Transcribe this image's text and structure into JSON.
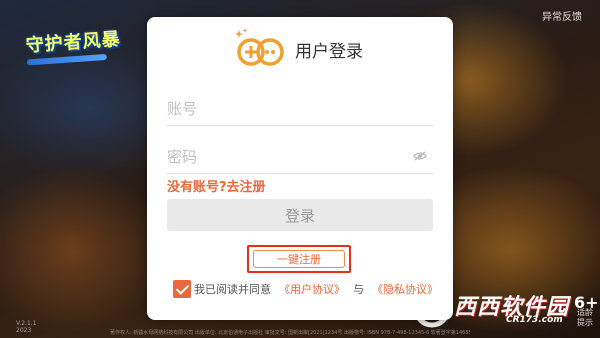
{
  "background": {
    "game_logo_text": "守护者风暴",
    "feedback_label": "异常反馈",
    "version_text": "V.2.1.1",
    "version_year": "2023",
    "side_stamp_big": "6+",
    "side_stamp_small": "适龄提示",
    "footer_line": "著作权人: 新疆水母网络科技有限公司  出版单位: 北京伯通电子出版社  审批文号: 国新出审[2021]1234号  出版物号: ISBN 978-7-498-12345-6  软著登字第14655819号-154",
    "watermark_brand": "西西软件园",
    "watermark_domain": "CR173.com"
  },
  "dialog": {
    "title": "用户登录",
    "account_placeholder": "账号",
    "password_placeholder": "密码",
    "no_account_link": "没有账号?去注册",
    "login_button": "登录",
    "one_click_register": "一键注册",
    "agree_prefix": "我已阅读并同意",
    "user_agreement": "《用户协议》",
    "and_word": "与",
    "privacy_policy": "《隐私协议》"
  },
  "colors": {
    "accent": "#e8683a",
    "highlight_border": "#e2301b",
    "button_disabled_bg": "#e9e9e9",
    "button_disabled_text": "#9a9a9a"
  }
}
